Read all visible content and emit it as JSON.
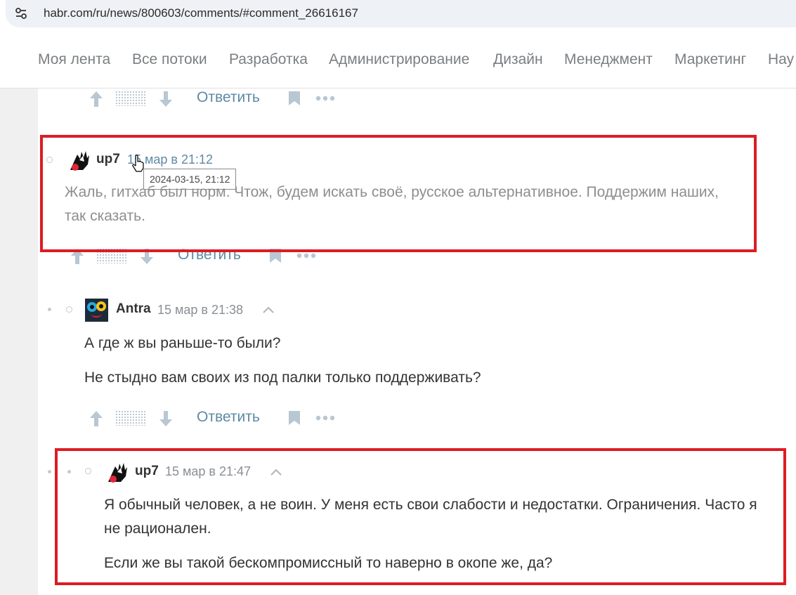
{
  "browser": {
    "url": "habr.com/ru/news/800603/comments/#comment_26616167"
  },
  "nav": {
    "items": [
      "Моя лента",
      "Все потоки",
      "Разработка",
      "Администрирование",
      "Дизайн",
      "Менеджмент",
      "Маркетинг",
      "Нау"
    ]
  },
  "actions": {
    "reply_label": "Ответить"
  },
  "comments": [
    {
      "username": "up7",
      "time": "15 мар в 21:12",
      "tooltip": "2024-03-15, 21:12",
      "paragraphs": [
        "Жаль, гитхаб был норм. Чтож, будем искать своё, русское альтернативное. Поддержим наших, так сказать."
      ]
    },
    {
      "username": "Antra",
      "time": "15 мар в 21:38",
      "paragraphs": [
        "А где ж вы раньше-то были?",
        "Не стыдно вам своих из под палки только поддерживать?"
      ]
    },
    {
      "username": "up7",
      "time": "15 мар в 21:47",
      "paragraphs": [
        "Я обычный человек, а не воин. У меня есть свои слабости и недостатки. Ограничения. Часто я не рационален.",
        "Если же вы такой бескомпромиссный то наверно в окопе же, да?"
      ]
    }
  ],
  "colors": {
    "highlight": "#dd1c24",
    "link": "#5e8aa4",
    "muted_text": "#8e8e8e"
  },
  "icons": [
    "site-settings-icon",
    "upvote-icon",
    "downvote-icon",
    "bookmark-icon",
    "more-icon",
    "collapse-chevron-icon",
    "hand-cursor-icon"
  ]
}
